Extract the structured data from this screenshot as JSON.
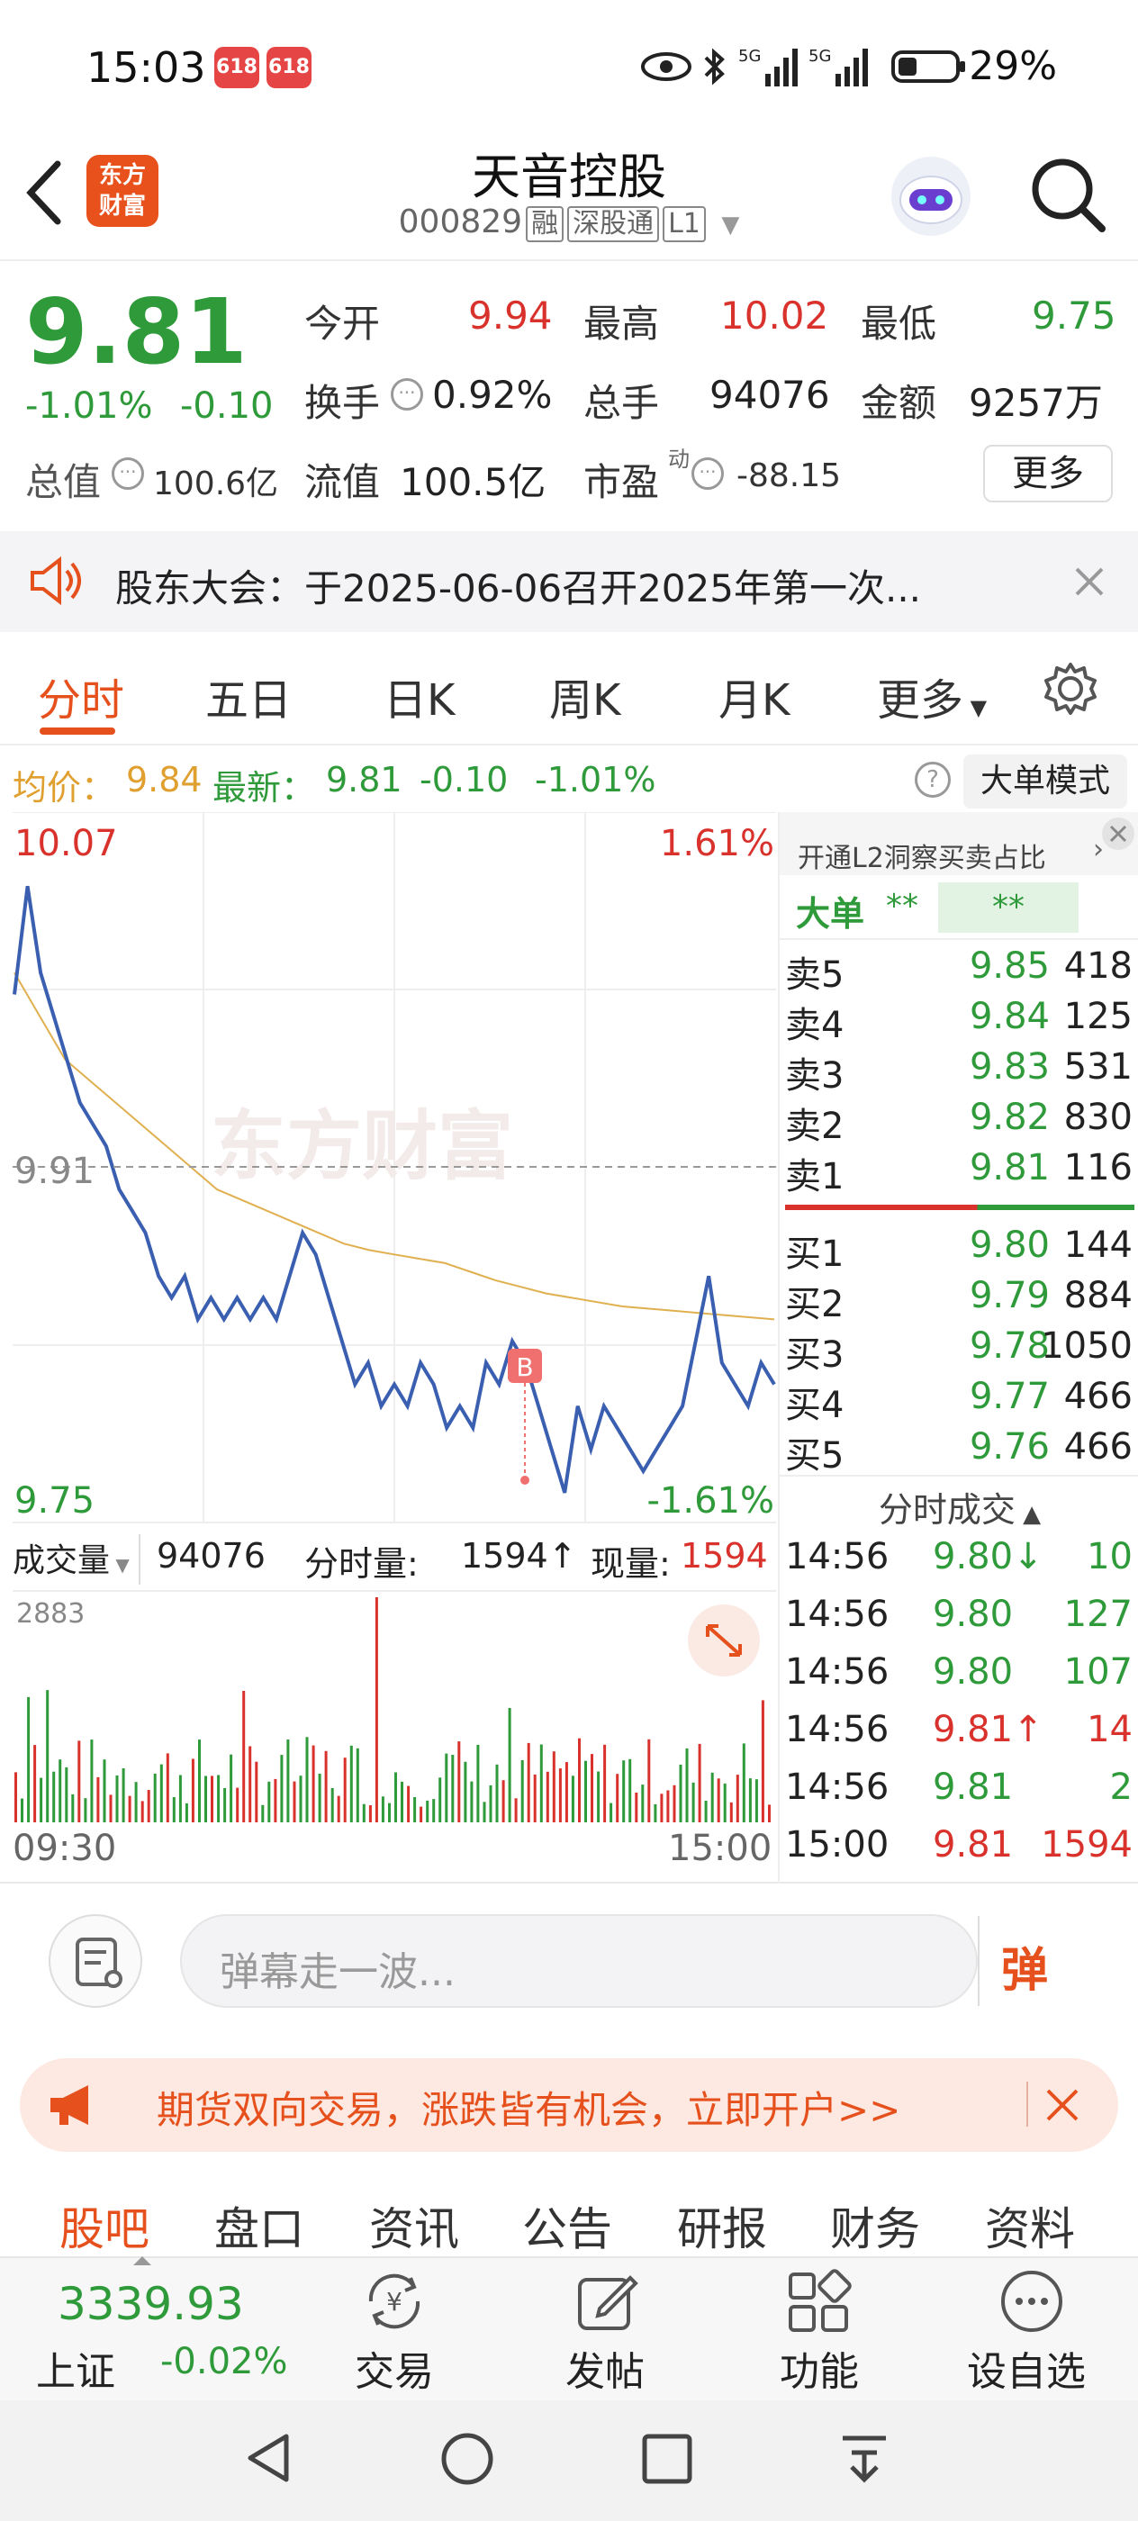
{
  "status_bar": {
    "time": "15:03",
    "app_badge": "618",
    "network": "5G",
    "battery": "29%"
  },
  "header": {
    "stock_name": "天音控股",
    "stock_code": "000829",
    "tags": [
      "融",
      "深股通",
      "L1"
    ],
    "logo_text_1": "东方",
    "logo_text_2": "财富"
  },
  "quote": {
    "price": "9.81",
    "change_pct": "-1.01%",
    "change": "-0.10",
    "open_label": "今开",
    "open": "9.94",
    "high_label": "最高",
    "high": "10.02",
    "low_label": "最低",
    "low": "9.75",
    "turnover_label": "换手",
    "turnover": "0.92%",
    "volume_label": "总手",
    "volume": "94076",
    "amount_label": "金额",
    "amount": "9257万",
    "mcap_label": "总值",
    "mcap": "100.6亿",
    "float_label": "流值",
    "float_mcap": "100.5亿",
    "pe_label": "市盈",
    "pe_sup": "动",
    "pe": "-88.15",
    "more": "更多"
  },
  "notice": {
    "text": "股东大会：于2025-06-06召开2025年第一次..."
  },
  "tabs": [
    "分时",
    "五日",
    "日K",
    "周K",
    "月K",
    "更多"
  ],
  "avg_row": {
    "avg_label": "均价：",
    "avg": "9.84",
    "latest_label": "最新：",
    "latest": "9.81",
    "change": "-0.10",
    "change_pct": "-1.01%",
    "mode_button": "大单模式"
  },
  "chart": {
    "y_top": "10.07",
    "y_mid": "9.91",
    "y_bottom": "9.75",
    "pct_top": "1.61%",
    "pct_bottom": "-1.61%",
    "watermark": "东方财富",
    "marker": "B",
    "vol_selector": "成交量",
    "vol_total": "94076",
    "vol_period_label": "分时量:",
    "vol_period": "1594↑",
    "vol_now_label": "现量:",
    "vol_now": "1594",
    "vol_max": "2883",
    "time_start": "09:30",
    "time_end": "15:00"
  },
  "chart_data": {
    "type": "line",
    "x_range": [
      "09:30",
      "15:00"
    ],
    "ylim": [
      9.75,
      10.07
    ],
    "series": [
      {
        "values": [
          9.99,
          10.04,
          10.0,
          9.98,
          9.96,
          9.94,
          9.93,
          9.92,
          9.9,
          9.89,
          9.88,
          9.86,
          9.85,
          9.86,
          9.84,
          9.85,
          9.84,
          9.85,
          9.84,
          9.85,
          9.84,
          9.86,
          9.88,
          9.87,
          9.85,
          9.83,
          9.81,
          9.82,
          9.8,
          9.81,
          9.8,
          9.82,
          9.81,
          9.79,
          9.8,
          9.79,
          9.82,
          9.81,
          9.83,
          9.82,
          9.8,
          9.78,
          9.76,
          9.8,
          9.78,
          9.8,
          9.79,
          9.78,
          9.77,
          9.78,
          9.79,
          9.8,
          9.83,
          9.86,
          9.82,
          9.81,
          9.8,
          9.82,
          9.81
        ]
      },
      {
        "values": [
          10.0,
          9.98,
          9.96,
          9.95,
          9.94,
          9.93,
          9.92,
          9.91,
          9.9,
          9.895,
          9.89,
          9.885,
          9.88,
          9.875,
          9.872,
          9.87,
          9.868,
          9.866,
          9.862,
          9.858,
          9.855,
          9.852,
          9.85,
          9.848,
          9.846,
          9.845,
          9.844,
          9.843,
          9.842,
          9.841,
          9.84
        ]
      }
    ],
    "volume_max": 2883
  },
  "orderbook": {
    "promo": "开通L2洞察买卖占比",
    "big_order_label": "大单",
    "big_order_val": "**",
    "big_order_val2": "**",
    "asks": [
      {
        "label": "卖5",
        "price": "9.85",
        "vol": "418"
      },
      {
        "label": "卖4",
        "price": "9.84",
        "vol": "125"
      },
      {
        "label": "卖3",
        "price": "9.83",
        "vol": "531"
      },
      {
        "label": "卖2",
        "price": "9.82",
        "vol": "830"
      },
      {
        "label": "卖1",
        "price": "9.81",
        "vol": "116"
      }
    ],
    "bids": [
      {
        "label": "买1",
        "price": "9.80",
        "vol": "144"
      },
      {
        "label": "买2",
        "price": "9.79",
        "vol": "884"
      },
      {
        "label": "买3",
        "price": "9.78",
        "vol": "1050"
      },
      {
        "label": "买4",
        "price": "9.77",
        "vol": "466"
      },
      {
        "label": "买5",
        "price": "9.76",
        "vol": "466"
      }
    ],
    "trades_title": "分时成交",
    "trades": [
      {
        "time": "14:56",
        "price": "9.80↓",
        "vol": "10"
      },
      {
        "time": "14:56",
        "price": "9.80",
        "vol": "127"
      },
      {
        "time": "14:56",
        "price": "9.80",
        "vol": "107"
      },
      {
        "time": "14:56",
        "price": "9.81↑",
        "vol": "14"
      },
      {
        "time": "14:56",
        "price": "9.81",
        "vol": "2"
      },
      {
        "time": "15:00",
        "price": "9.81",
        "vol": "1594"
      }
    ]
  },
  "comment": {
    "placeholder": "弹幕走一波...",
    "send_label": "弹"
  },
  "ad": {
    "text": "期货双向交易，涨跌皆有机会，立即开户>>"
  },
  "bottom_tabs": [
    "股吧",
    "盘口",
    "资讯",
    "公告",
    "研报",
    "财务",
    "资料"
  ],
  "toolbar": {
    "index_value": "3339.93",
    "index_name": "上证",
    "index_change": "-0.02%",
    "items": [
      "交易",
      "发帖",
      "功能",
      "设自选"
    ]
  },
  "colors": {
    "up": "#d9312b",
    "down": "#2e9a3a",
    "accent": "#e5501c",
    "price_line": "#3a5fb0",
    "avg_line": "#e0b050"
  }
}
